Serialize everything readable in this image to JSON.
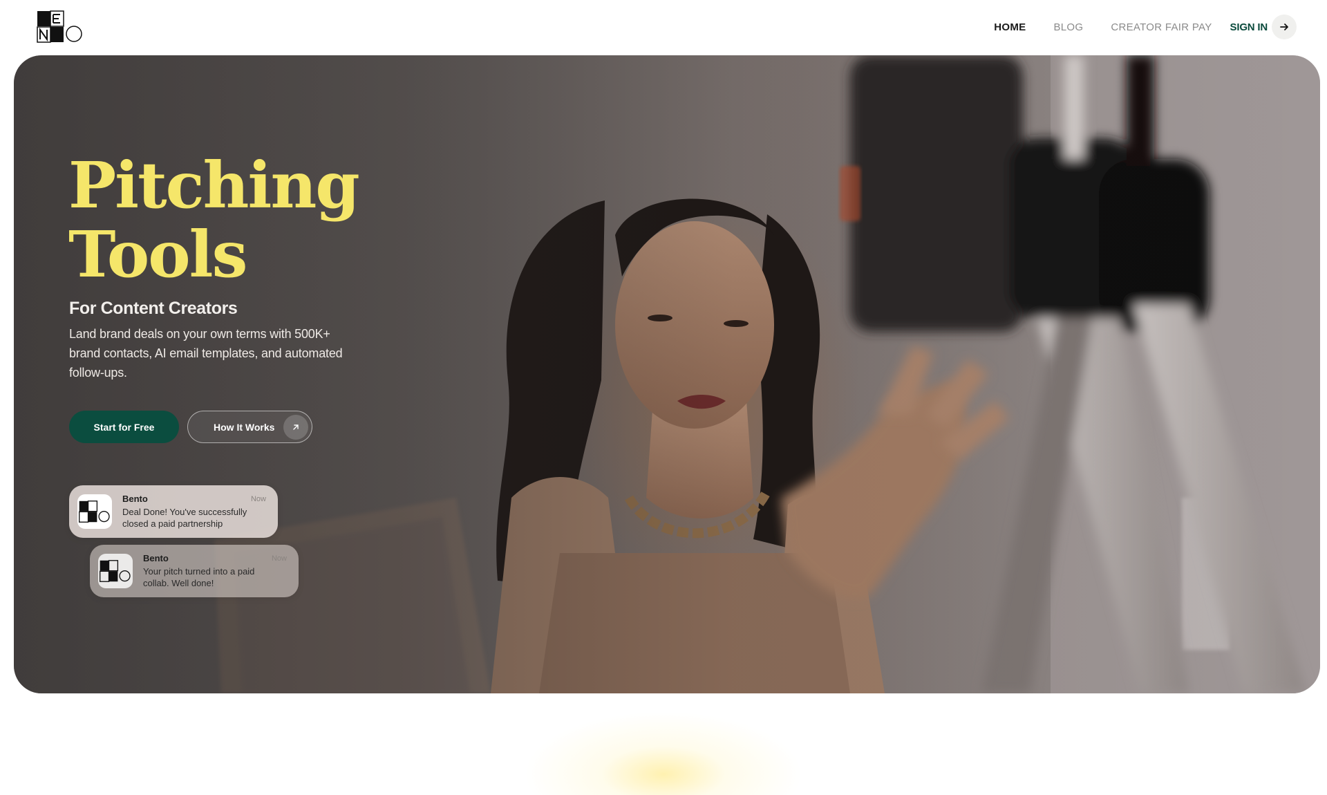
{
  "header": {
    "logo_icon": "bento-logo",
    "nav": [
      {
        "label": "HOME",
        "active": true
      },
      {
        "label": "BLOG",
        "active": false
      },
      {
        "label": "CREATOR FAIR PAY",
        "active": false
      }
    ],
    "signin_label": "SIGN IN",
    "signin_icon": "arrow-right-icon"
  },
  "hero": {
    "title_line1": "Pitching",
    "title_line2": "Tools",
    "subtitle": "For Content Creators",
    "description": "Land brand deals on your own terms with 500K+ brand contacts, AI email templates, and automated follow-ups.",
    "primary_button": "Start for Free",
    "secondary_button": "How It Works",
    "secondary_icon": "arrow-up-right-icon",
    "colors": {
      "title": "#f5e66a",
      "primary_button": "#0b4d3f",
      "signin": "#0a4a3c"
    }
  },
  "notifications": [
    {
      "app": "Bento",
      "time": "Now",
      "message": "Deal Done! You've successfully closed a paid partnership",
      "icon": "bento-app-icon"
    },
    {
      "app": "Bento",
      "time": "Now",
      "message": "Your pitch turned into a paid collab. Well done!",
      "icon": "bento-app-icon"
    }
  ]
}
